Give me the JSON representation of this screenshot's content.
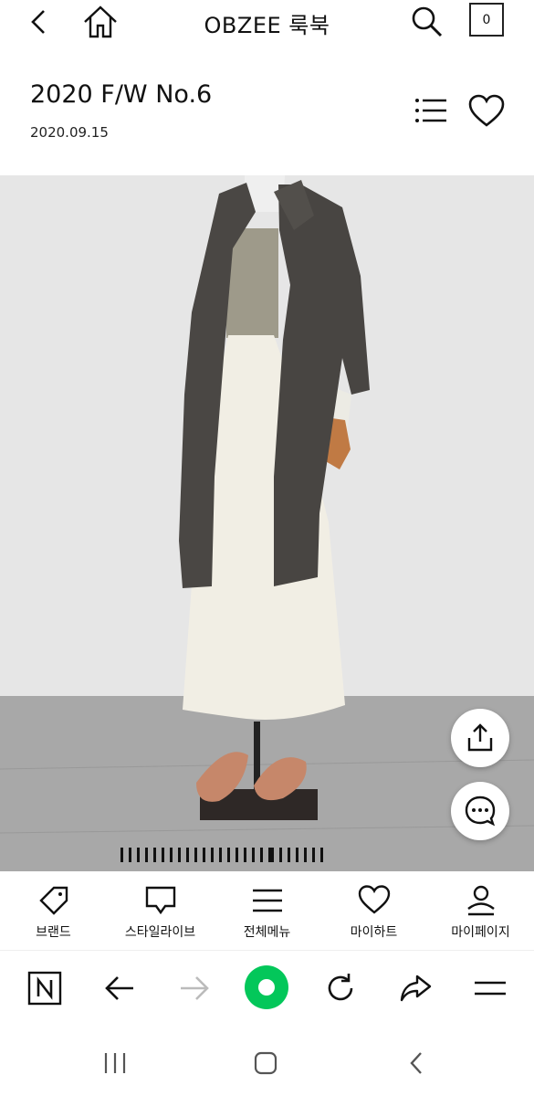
{
  "header": {
    "title": "OBZEE 룩북",
    "cart_count": "0",
    "back_icon": "chevron-left-icon",
    "home_icon": "home-icon",
    "search_icon": "search-icon"
  },
  "look": {
    "title": "2020 F/W No.6",
    "date": "2020.09.15"
  },
  "gallery": {
    "ticks_total": 25,
    "active_index": 18
  },
  "bottom_nav": [
    {
      "label": "브랜드",
      "icon": "tag-icon"
    },
    {
      "label": "스타일라이브",
      "icon": "chat-bubble-icon"
    },
    {
      "label": "전체메뉴",
      "icon": "menu-icon"
    },
    {
      "label": "마이하트",
      "icon": "heart-icon"
    },
    {
      "label": "마이페이지",
      "icon": "user-icon"
    }
  ],
  "colors": {
    "accent_green": "#03c75a",
    "wall": "#e6e6e6",
    "floor": "#a9a9a9"
  }
}
